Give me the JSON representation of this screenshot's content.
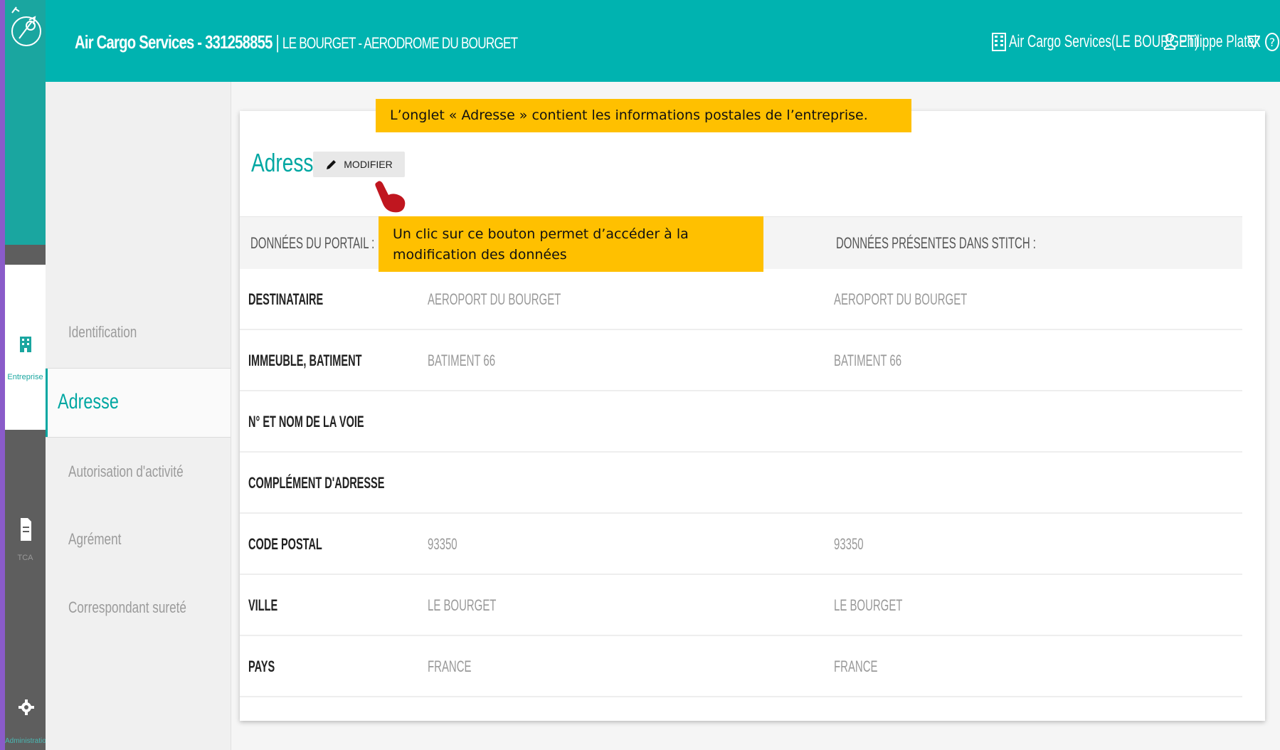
{
  "header": {
    "company": "Air Cargo Services - 331258855",
    "separator": "|",
    "location": "LE BOURGET - AERODROME DU BOURGET",
    "org_selector": "Air Cargo Services(LE BOURGET)",
    "user_name": "Philippe Platek",
    "icons": [
      "building-icon",
      "user-icon",
      "filter-icon",
      "help-icon"
    ]
  },
  "rail": {
    "items": [
      {
        "label": "Entreprise",
        "icon": "building-icon"
      },
      {
        "label": "TCA",
        "icon": "document-icon"
      },
      {
        "label": "Administration",
        "icon": "gear-icon"
      }
    ]
  },
  "subnav": {
    "items": [
      {
        "label": "Identification"
      },
      {
        "label": "Adresse",
        "active": true
      },
      {
        "label": "Autorisation d'activité"
      },
      {
        "label": "Agrément"
      },
      {
        "label": "Correspondant sureté"
      }
    ]
  },
  "card": {
    "title": "Adresse",
    "modify_label": "MODIFIER",
    "col_portal": "DONNÉES DU PORTAIL :",
    "col_stitch": "DONNÉES PRÉSENTES DANS STITCH :",
    "rows": [
      {
        "key": "DESTINATAIRE",
        "portal": "AEROPORT DU BOURGET",
        "stitch": "AEROPORT DU BOURGET"
      },
      {
        "key": "IMMEUBLE, BATIMENT",
        "portal": "BATIMENT 66",
        "stitch": "BATIMENT 66"
      },
      {
        "key": "N° ET NOM DE LA VOIE",
        "portal": "",
        "stitch": ""
      },
      {
        "key": "COMPLÉMENT D'ADRESSE",
        "portal": "",
        "stitch": ""
      },
      {
        "key": "CODE POSTAL",
        "portal": "93350",
        "stitch": "93350"
      },
      {
        "key": "VILLE",
        "portal": "LE BOURGET",
        "stitch": "LE BOURGET"
      },
      {
        "key": "PAYS",
        "portal": "FRANCE",
        "stitch": "FRANCE"
      }
    ]
  },
  "annotations": {
    "tip_tab": "L’onglet « Adresse » contient les informations postales de l’entreprise.",
    "tip_button": "Un clic sur ce bouton permet d’accéder à la modification des données"
  },
  "colors": {
    "header_bg": "#00b3b0",
    "accent": "#00a7a2",
    "tooltip_bg": "#ffc000",
    "rail_dark": "#5e5e5e"
  }
}
